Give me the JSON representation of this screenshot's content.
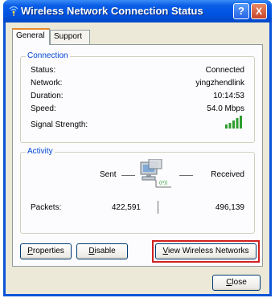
{
  "window": {
    "title": "Wireless Network Connection Status",
    "help_label": "?",
    "close_label": "X"
  },
  "tabs": [
    {
      "label": "General",
      "active": true
    },
    {
      "label": "Support",
      "active": false
    }
  ],
  "connection": {
    "legend": "Connection",
    "rows": [
      {
        "label": "Status:",
        "value": "Connected"
      },
      {
        "label": "Network:",
        "value": "yingzhendlink"
      },
      {
        "label": "Duration:",
        "value": "10:14:53"
      },
      {
        "label": "Speed:",
        "value": "54.0 Mbps"
      }
    ],
    "signal_label": "Signal Strength:",
    "signal_bars_lit": 5,
    "signal_bars_total": 5
  },
  "activity": {
    "legend": "Activity",
    "sent_label": "Sent",
    "received_label": "Received",
    "packets_label": "Packets:",
    "packets_sent": "422,591",
    "packets_received": "496,139"
  },
  "buttons": {
    "properties": {
      "label": "Properties",
      "mnemonic": "P",
      "rest": "roperties"
    },
    "disable": {
      "label": "Disable",
      "mnemonic": "D",
      "rest": "isable"
    },
    "view_networks": {
      "label": "View Wireless Networks",
      "mnemonic": "V",
      "rest": "iew Wireless Networks"
    },
    "close": {
      "label": "Close",
      "mnemonic": "C",
      "rest": "lose"
    }
  },
  "colors": {
    "titlebar": "#0054e3",
    "group_legend": "#0046d5",
    "signal": "#2f9e2f",
    "highlight": "#d0211f"
  }
}
